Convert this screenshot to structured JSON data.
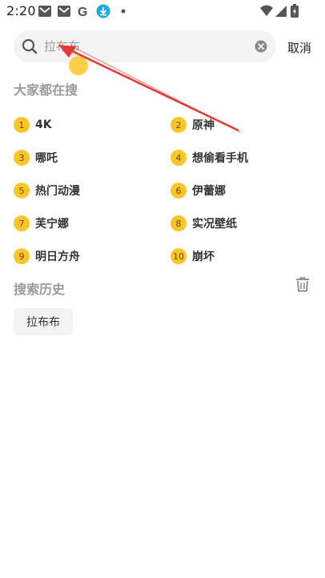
{
  "status_bar": {
    "time": "2:20",
    "icons": [
      "gmail-icon",
      "gmail-icon",
      "google-icon",
      "download-icon",
      "dot-icon",
      "wifi-icon",
      "signal-icon",
      "battery-icon"
    ]
  },
  "search": {
    "placeholder": "拉布布",
    "value": "",
    "cancel_label": "取消"
  },
  "trending": {
    "title": "大家都在搜",
    "items": [
      {
        "rank": "1",
        "label": "4K"
      },
      {
        "rank": "2",
        "label": "原神"
      },
      {
        "rank": "3",
        "label": "哪吒"
      },
      {
        "rank": "4",
        "label": "想偷看手机"
      },
      {
        "rank": "5",
        "label": "热门动漫"
      },
      {
        "rank": "6",
        "label": "伊蕾娜"
      },
      {
        "rank": "7",
        "label": "芙宁娜"
      },
      {
        "rank": "8",
        "label": "实况壁纸"
      },
      {
        "rank": "9",
        "label": "明日方舟"
      },
      {
        "rank": "10",
        "label": "崩坏"
      }
    ]
  },
  "history": {
    "title": "搜索历史",
    "items": [
      {
        "label": "拉布布"
      }
    ]
  },
  "colors": {
    "badge": "#fcc629",
    "annotation_arrow": "#e53935"
  }
}
